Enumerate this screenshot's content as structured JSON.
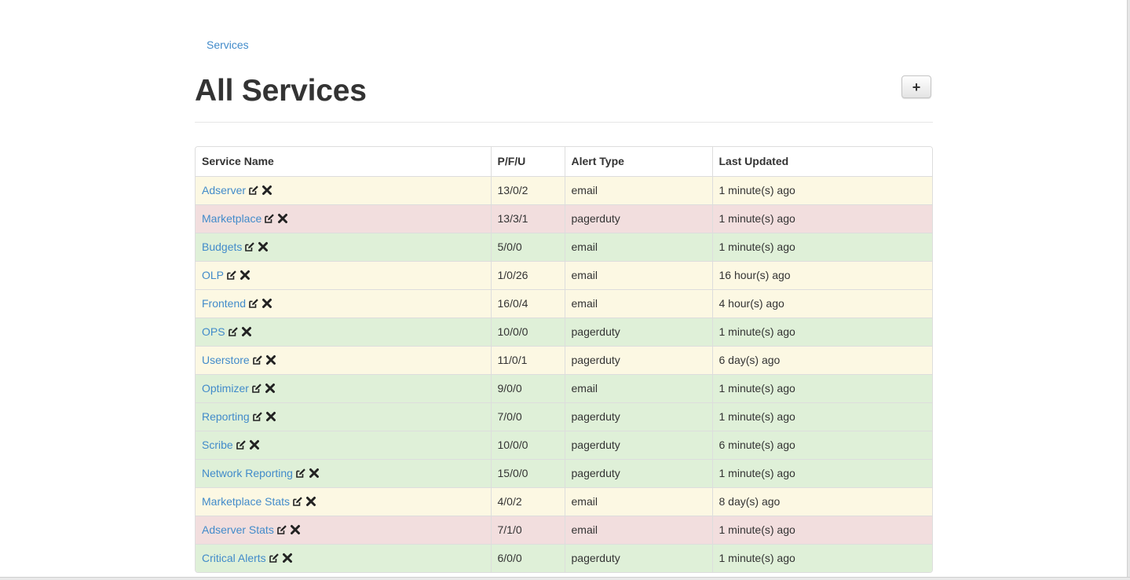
{
  "breadcrumb": {
    "label": "Services"
  },
  "header": {
    "title": "All Services",
    "add_label": "+"
  },
  "table": {
    "columns": [
      "Service Name",
      "P/F/U",
      "Alert Type",
      "Last Updated"
    ],
    "rows": [
      {
        "name": "Adserver",
        "pfu": "13/0/2",
        "alert": "email",
        "updated": "1 minute(s) ago",
        "status": "warning"
      },
      {
        "name": "Marketplace",
        "pfu": "13/3/1",
        "alert": "pagerduty",
        "updated": "1 minute(s) ago",
        "status": "danger"
      },
      {
        "name": "Budgets",
        "pfu": "5/0/0",
        "alert": "email",
        "updated": "1 minute(s) ago",
        "status": "success"
      },
      {
        "name": "OLP",
        "pfu": "1/0/26",
        "alert": "email",
        "updated": "16 hour(s) ago",
        "status": "warning"
      },
      {
        "name": "Frontend",
        "pfu": "16/0/4",
        "alert": "email",
        "updated": "4 hour(s) ago",
        "status": "warning"
      },
      {
        "name": "OPS",
        "pfu": "10/0/0",
        "alert": "pagerduty",
        "updated": "1 minute(s) ago",
        "status": "success"
      },
      {
        "name": "Userstore",
        "pfu": "11/0/1",
        "alert": "pagerduty",
        "updated": "6 day(s) ago",
        "status": "warning"
      },
      {
        "name": "Optimizer",
        "pfu": "9/0/0",
        "alert": "email",
        "updated": "1 minute(s) ago",
        "status": "success"
      },
      {
        "name": "Reporting",
        "pfu": "7/0/0",
        "alert": "pagerduty",
        "updated": "1 minute(s) ago",
        "status": "success"
      },
      {
        "name": "Scribe",
        "pfu": "10/0/0",
        "alert": "pagerduty",
        "updated": "6 minute(s) ago",
        "status": "success"
      },
      {
        "name": "Network Reporting",
        "pfu": "15/0/0",
        "alert": "pagerduty",
        "updated": "1 minute(s) ago",
        "status": "success"
      },
      {
        "name": "Marketplace Stats",
        "pfu": "4/0/2",
        "alert": "email",
        "updated": "8 day(s) ago",
        "status": "warning"
      },
      {
        "name": "Adserver Stats",
        "pfu": "7/1/0",
        "alert": "email",
        "updated": "1 minute(s) ago",
        "status": "danger"
      },
      {
        "name": "Critical Alerts",
        "pfu": "6/0/0",
        "alert": "pagerduty",
        "updated": "1 minute(s) ago",
        "status": "success"
      }
    ]
  },
  "icons": {
    "edit": "edit-icon",
    "delete": "delete-icon"
  },
  "colors": {
    "link": "#428bca",
    "row_warning": "#fcf8e3",
    "row_danger": "#f2dede",
    "row_success": "#dff0d8"
  }
}
